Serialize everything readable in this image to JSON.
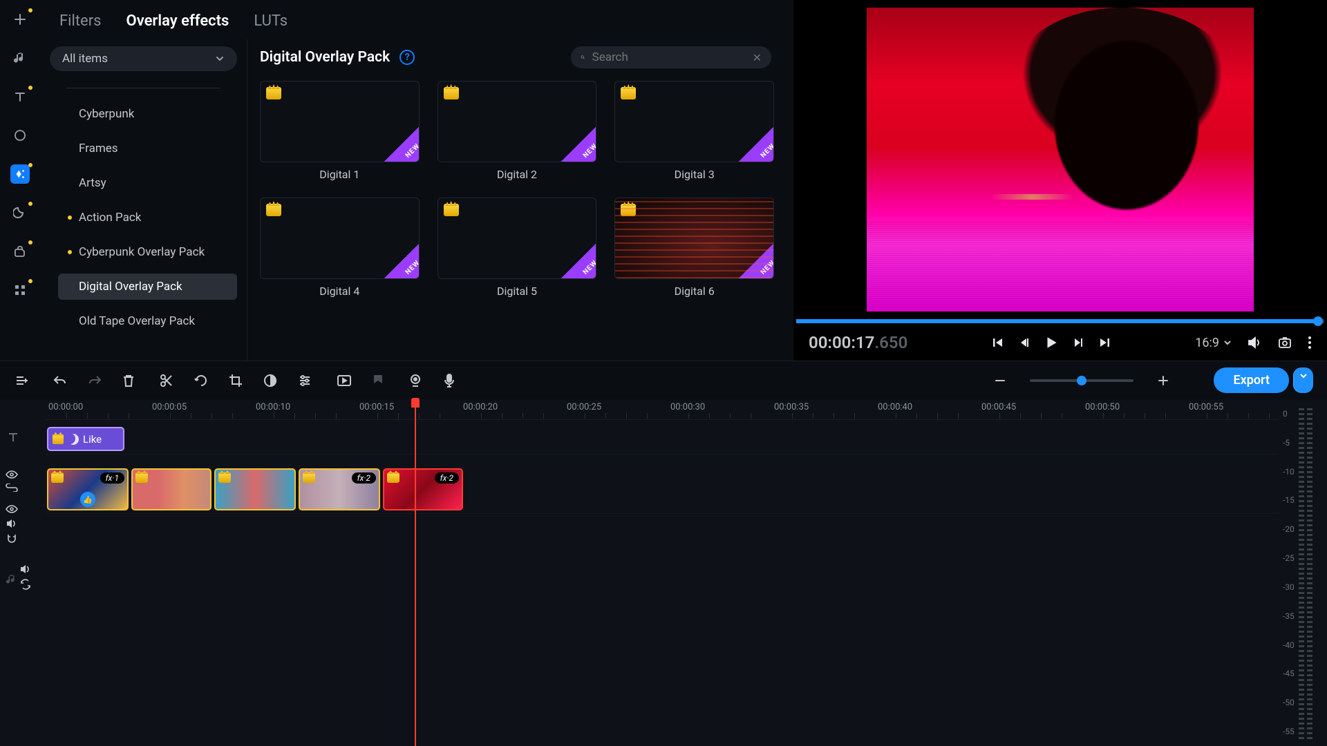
{
  "tabs": {
    "filters": "Filters",
    "overlays": "Overlay effects",
    "luts": "LUTs"
  },
  "category_dropdown": "All items",
  "categories": [
    {
      "label": "Cyberpunk",
      "bullet": false,
      "active": false
    },
    {
      "label": "Frames",
      "bullet": false,
      "active": false
    },
    {
      "label": "Artsy",
      "bullet": false,
      "active": false
    },
    {
      "label": "Action Pack",
      "bullet": true,
      "active": false
    },
    {
      "label": "Cyberpunk Overlay Pack",
      "bullet": true,
      "active": false
    },
    {
      "label": "Digital Overlay Pack",
      "bullet": false,
      "active": true
    },
    {
      "label": "Old Tape Overlay Pack",
      "bullet": false,
      "active": false
    }
  ],
  "grid_title": "Digital Overlay Pack",
  "search_placeholder": "Search",
  "overlays": [
    {
      "label": "Digital 1",
      "premium": true,
      "new": true,
      "variant": ""
    },
    {
      "label": "Digital 2",
      "premium": true,
      "new": true,
      "variant": ""
    },
    {
      "label": "Digital 3",
      "premium": true,
      "new": true,
      "variant": ""
    },
    {
      "label": "Digital 4",
      "premium": true,
      "new": true,
      "variant": ""
    },
    {
      "label": "Digital 5",
      "premium": true,
      "new": true,
      "variant": ""
    },
    {
      "label": "Digital 6",
      "premium": true,
      "new": true,
      "variant": "d6"
    }
  ],
  "new_label": "NEW",
  "timecode_main": "00:00:17",
  "timecode_frac": ".650",
  "aspect_ratio": "16:9",
  "export_label": "Export",
  "ruler": [
    "00:00:00",
    "00:00:05",
    "00:00:10",
    "00:00:15",
    "00:00:20",
    "00:00:25",
    "00:00:30",
    "00:00:35",
    "00:00:40",
    "00:00:45",
    "00:00:50",
    "00:00:55"
  ],
  "intro_clip_label": "Like",
  "fx_badges": {
    "fx1": "fx·1",
    "fx2": "fx·2"
  },
  "meter_levels": [
    "0",
    "-5",
    "-10",
    "-15",
    "-20",
    "-25",
    "-30",
    "-35",
    "-40",
    "-45",
    "-50",
    "-55"
  ]
}
